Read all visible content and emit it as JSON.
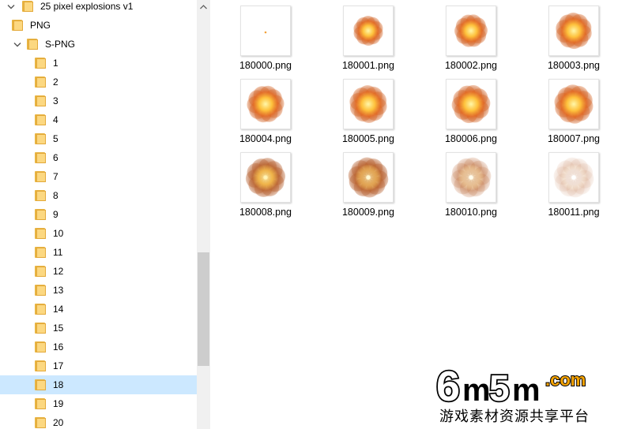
{
  "tree": [
    {
      "label": "25 pixel explosions v1",
      "depth": 0,
      "expanded": true,
      "selected": false
    },
    {
      "label": "PNG",
      "depth": 1,
      "expanded": null,
      "selected": false
    },
    {
      "label": "S-PNG",
      "depth": 1,
      "expanded": true,
      "selected": false
    },
    {
      "label": "1",
      "depth": 2,
      "expanded": null,
      "selected": false
    },
    {
      "label": "2",
      "depth": 2,
      "expanded": null,
      "selected": false
    },
    {
      "label": "3",
      "depth": 2,
      "expanded": null,
      "selected": false
    },
    {
      "label": "4",
      "depth": 2,
      "expanded": null,
      "selected": false
    },
    {
      "label": "5",
      "depth": 2,
      "expanded": null,
      "selected": false
    },
    {
      "label": "6",
      "depth": 2,
      "expanded": null,
      "selected": false
    },
    {
      "label": "7",
      "depth": 2,
      "expanded": null,
      "selected": false
    },
    {
      "label": "8",
      "depth": 2,
      "expanded": null,
      "selected": false
    },
    {
      "label": "9",
      "depth": 2,
      "expanded": null,
      "selected": false
    },
    {
      "label": "10",
      "depth": 2,
      "expanded": null,
      "selected": false
    },
    {
      "label": "11",
      "depth": 2,
      "expanded": null,
      "selected": false
    },
    {
      "label": "12",
      "depth": 2,
      "expanded": null,
      "selected": false
    },
    {
      "label": "13",
      "depth": 2,
      "expanded": null,
      "selected": false
    },
    {
      "label": "14",
      "depth": 2,
      "expanded": null,
      "selected": false
    },
    {
      "label": "15",
      "depth": 2,
      "expanded": null,
      "selected": false
    },
    {
      "label": "16",
      "depth": 2,
      "expanded": null,
      "selected": false
    },
    {
      "label": "17",
      "depth": 2,
      "expanded": null,
      "selected": false
    },
    {
      "label": "18",
      "depth": 2,
      "expanded": null,
      "selected": true
    },
    {
      "label": "19",
      "depth": 2,
      "expanded": null,
      "selected": false
    },
    {
      "label": "20",
      "depth": 2,
      "expanded": null,
      "selected": false
    }
  ],
  "icons": {
    "folder": "folder-icon",
    "expand": "chevron-down-icon",
    "scroll_up": "scroll-up-arrow-icon"
  },
  "colors": {
    "selection": "#cce8ff",
    "folder_front": "#fcd881",
    "folder_back": "#e8b442",
    "scrollbar_track": "#f0f0f0",
    "scrollbar_thumb": "#cdcdcd",
    "watermark_orange": "#f5a300"
  },
  "files": [
    {
      "name": "180000.png",
      "stage": 0
    },
    {
      "name": "180001.png",
      "stage": 1
    },
    {
      "name": "180002.png",
      "stage": 2
    },
    {
      "name": "180003.png",
      "stage": 3
    },
    {
      "name": "180004.png",
      "stage": 4
    },
    {
      "name": "180005.png",
      "stage": 5
    },
    {
      "name": "180006.png",
      "stage": 6
    },
    {
      "name": "180007.png",
      "stage": 7
    },
    {
      "name": "180008.png",
      "stage": 8
    },
    {
      "name": "180009.png",
      "stage": 9
    },
    {
      "name": "180010.png",
      "stage": 10
    },
    {
      "name": "180011.png",
      "stage": 11
    }
  ],
  "watermark": {
    "logo_digit_1": "6",
    "logo_letter_1": "m",
    "logo_digit_2": "5",
    "logo_letter_2": "m",
    "logo_domain": ".com",
    "tagline": "游戏素材资源共享平台"
  }
}
